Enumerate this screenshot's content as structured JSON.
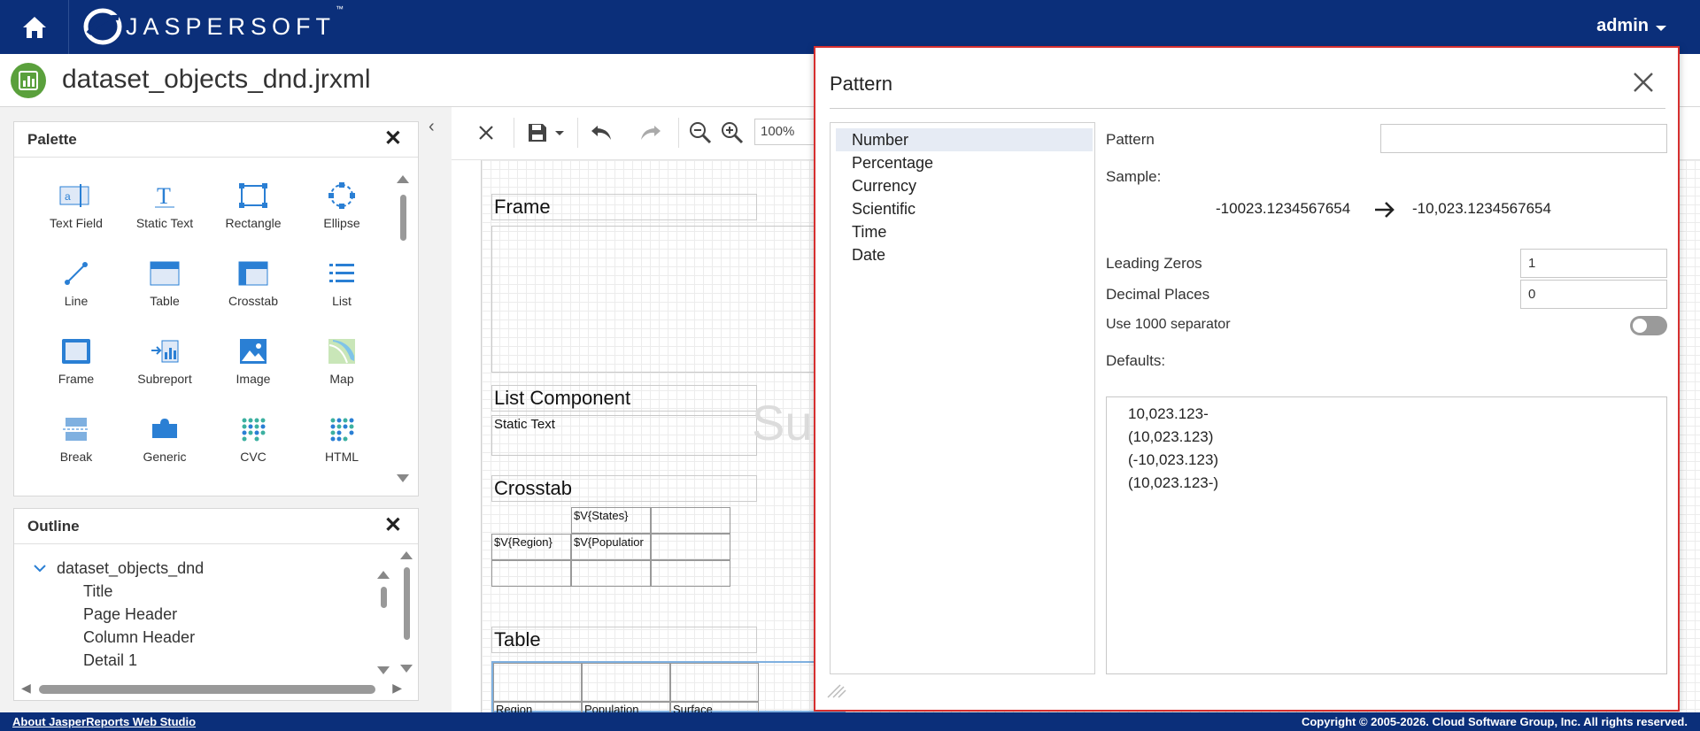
{
  "header": {
    "brand": "JASPERSOFT",
    "brand_tm": "™",
    "user": "admin"
  },
  "titlebar": {
    "title": "dataset_objects_dnd.jrxml"
  },
  "palette": {
    "title": "Palette",
    "items": [
      {
        "label": "Text Field",
        "icon": "text-field-icon"
      },
      {
        "label": "Static Text",
        "icon": "static-text-icon"
      },
      {
        "label": "Rectangle",
        "icon": "rectangle-icon"
      },
      {
        "label": "Ellipse",
        "icon": "ellipse-icon"
      },
      {
        "label": "Line",
        "icon": "line-icon"
      },
      {
        "label": "Table",
        "icon": "table-icon"
      },
      {
        "label": "Crosstab",
        "icon": "crosstab-icon"
      },
      {
        "label": "List",
        "icon": "list-icon"
      },
      {
        "label": "Frame",
        "icon": "frame-icon"
      },
      {
        "label": "Subreport",
        "icon": "subreport-icon"
      },
      {
        "label": "Image",
        "icon": "image-icon"
      },
      {
        "label": "Map",
        "icon": "map-icon"
      },
      {
        "label": "Break",
        "icon": "break-icon"
      },
      {
        "label": "Generic",
        "icon": "generic-icon"
      },
      {
        "label": "CVC",
        "icon": "cvc-icon"
      },
      {
        "label": "HTML",
        "icon": "html-icon"
      }
    ]
  },
  "outline": {
    "title": "Outline",
    "root": "dataset_objects_dnd",
    "children": [
      "Title",
      "Page Header",
      "Column Header",
      "Detail 1"
    ]
  },
  "toolbar": {
    "zoom": "100%"
  },
  "canvas": {
    "frame_label": "Frame",
    "list_label": "List Component",
    "list_static_text": "Static Text",
    "watermark": "Sur",
    "crosstab_label": "Crosstab",
    "crosstab_states": "$V{States}",
    "crosstab_region": "$V{Region}",
    "crosstab_population": "$V{Populatior",
    "table_label": "Table",
    "table_headers": [
      "Region",
      "Population",
      "Surface"
    ]
  },
  "dialog": {
    "title": "Pattern",
    "categories": [
      "Number",
      "Percentage",
      "Currency",
      "Scientific",
      "Time",
      "Date"
    ],
    "selected_category": "Number",
    "pattern_label": "Pattern",
    "pattern_value": "",
    "sample_label": "Sample:",
    "sample_input": "-10023.1234567654",
    "sample_output": "-10,023.1234567654",
    "leading_zeros_label": "Leading Zeros",
    "leading_zeros_value": "1",
    "decimal_places_label": "Decimal Places",
    "decimal_places_value": "0",
    "separator_label": "Use 1000 separator",
    "separator_on": false,
    "defaults_label": "Defaults:",
    "defaults": [
      "10,023.123-",
      "(10,023.123)",
      "(-10,023.123)",
      "(10,023.123-)"
    ]
  },
  "footer": {
    "about_link": "About JasperReports Web Studio",
    "copyright": "Copyright © 2005-2026. Cloud Software Group, Inc. All rights reserved."
  },
  "colors": {
    "topbar": "#0b2f7a",
    "dialog_border": "#d62f2f",
    "report_icon": "#5aa03c",
    "accent_blue": "#2a7fd4"
  }
}
